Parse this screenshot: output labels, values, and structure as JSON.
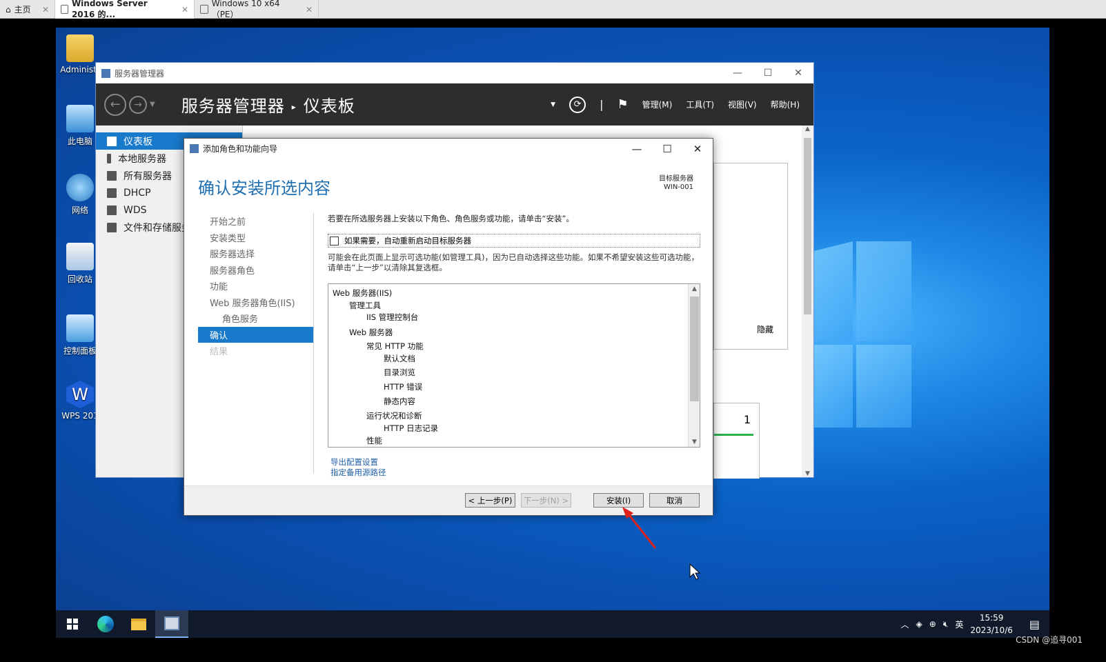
{
  "host": {
    "tabs": [
      {
        "label": "主页"
      },
      {
        "label": "Windows Server 2016 的..."
      },
      {
        "label": "Windows 10 x64（PE）"
      }
    ]
  },
  "desktop": {
    "icons": [
      {
        "label": "Administr"
      },
      {
        "label": "此电脑"
      },
      {
        "label": "网络"
      },
      {
        "label": "回收站"
      },
      {
        "label": "控制面板"
      },
      {
        "label": "WPS 201"
      }
    ]
  },
  "server_manager": {
    "title": "服务器管理器",
    "crumb_root": "服务器管理器",
    "crumb_page": "仪表板",
    "menu": [
      "管理(M)",
      "工具(T)",
      "视图(V)",
      "帮助(H)"
    ],
    "sidebar": [
      {
        "label": "仪表板"
      },
      {
        "label": "本地服务器"
      },
      {
        "label": "所有服务器"
      },
      {
        "label": "DHCP"
      },
      {
        "label": "WDS"
      },
      {
        "label": "文件和存储服务"
      }
    ],
    "hide_label": "隐藏",
    "count_value": "1"
  },
  "wizard": {
    "title": "添加角色和功能向导",
    "heading": "确认安装所选内容",
    "target_label": "目标服务器",
    "target_name": "WIN-001",
    "steps": [
      {
        "label": "开始之前"
      },
      {
        "label": "安装类型"
      },
      {
        "label": "服务器选择"
      },
      {
        "label": "服务器角色"
      },
      {
        "label": "功能"
      },
      {
        "label": "Web 服务器角色(IIS)"
      },
      {
        "label": "角色服务"
      },
      {
        "label": "确认"
      },
      {
        "label": "结果"
      }
    ],
    "description": "若要在所选服务器上安装以下角色、角色服务或功能，请单击“安装”。",
    "restart_checkbox": "如果需要，自动重新启动目标服务器",
    "note": "可能会在此页面上显示可选功能(如管理工具)，因为已自动选择这些功能。如果不希望安装这些可选功能，请单击“上一步”以清除其复选框。",
    "features": [
      {
        "label": "Web 服务器(IIS)"
      },
      {
        "label": "管理工具"
      },
      {
        "label": "IIS 管理控制台"
      },
      {
        "label": "Web 服务器"
      },
      {
        "label": "常见 HTTP 功能"
      },
      {
        "label": "默认文档"
      },
      {
        "label": "目录浏览"
      },
      {
        "label": "HTTP 错误"
      },
      {
        "label": "静态内容"
      },
      {
        "label": "运行状况和诊断"
      },
      {
        "label": "HTTP 日志记录"
      },
      {
        "label": "性能"
      }
    ],
    "export_link": "导出配置设置",
    "alt_source_link": "指定备用源路径",
    "btn_prev": "< 上一步(P)",
    "btn_next": "下一步(N) >",
    "btn_install": "安装(I)",
    "btn_cancel": "取消"
  },
  "taskbar": {
    "tray_lang": "英",
    "time": "15:59",
    "date": "2023/10/6"
  },
  "watermark": "CSDN @追寻001"
}
